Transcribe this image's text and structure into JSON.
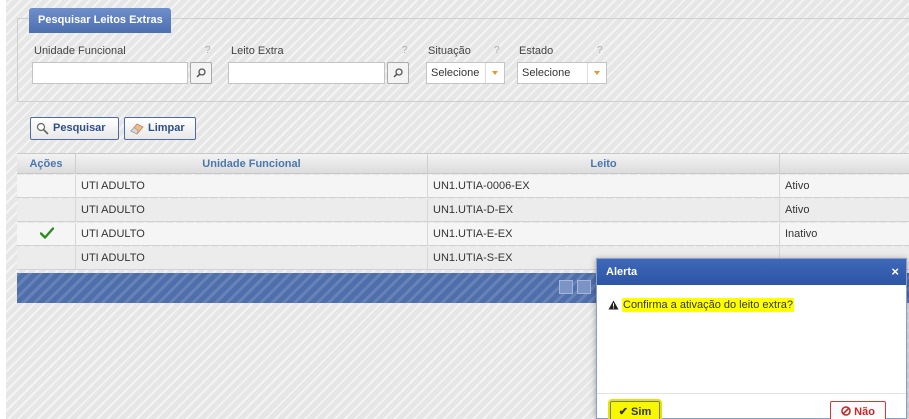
{
  "search_panel": {
    "title": "Pesquisar Leitos Extras",
    "help": "?",
    "unidade_funcional": {
      "label": "Unidade Funcional",
      "value": ""
    },
    "leito_extra": {
      "label": "Leito Extra",
      "value": ""
    },
    "situacao": {
      "label": "Situação",
      "selected": "Selecione"
    },
    "estado": {
      "label": "Estado",
      "selected": "Selecione"
    }
  },
  "actions": {
    "search_label": "Pesquisar",
    "clear_label": "Limpar"
  },
  "table": {
    "headers": [
      "Ações",
      "Unidade Funcional",
      "Leito",
      ""
    ],
    "rows": [
      {
        "action_icon": "",
        "unidade": "UTI ADULTO",
        "leito": "UN1.UTIA-0006-EX",
        "status": "Ativo"
      },
      {
        "action_icon": "",
        "unidade": "UTI ADULTO",
        "leito": "UN1.UTIA-D-EX",
        "status": "Ativo"
      },
      {
        "action_icon": "check-icon",
        "unidade": "UTI ADULTO",
        "leito": "UN1.UTIA-E-EX",
        "status": "Inativo"
      },
      {
        "action_icon": "",
        "unidade": "UTI ADULTO",
        "leito": "UN1.UTIA-S-EX",
        "status": ""
      }
    ]
  },
  "modal": {
    "title": "Alerta",
    "close": "×",
    "message": "Confirma a ativação do leito extra?",
    "confirm_label": "Sim",
    "cancel_label": "Não"
  },
  "colors": {
    "accent": "#3f68b9",
    "highlight": "#ffff00",
    "check": "#2e8b1e",
    "danger": "#c62828"
  }
}
